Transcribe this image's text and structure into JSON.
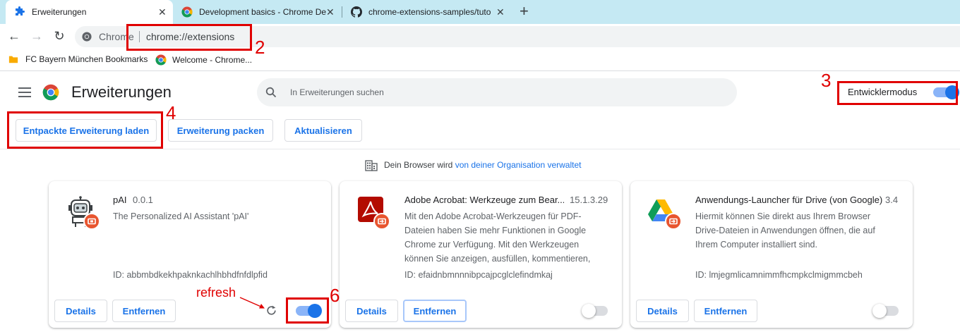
{
  "tabs": [
    {
      "label": "Erweiterungen",
      "icon": "puzzle-icon",
      "active": true
    },
    {
      "label": "Development basics - Chrome De",
      "icon": "chrome-logo-icon",
      "active": false
    },
    {
      "label": "chrome-extensions-samples/tuto",
      "icon": "github-icon",
      "active": false
    }
  ],
  "toolbar": {
    "omnibox_chip": "Chrome",
    "url": "chrome://extensions"
  },
  "bookmarks": [
    {
      "label": "FC Bayern München Bookmarks",
      "icon": "folder-icon"
    },
    {
      "label": "Welcome - Chrome...",
      "icon": "chrome-logo-icon"
    }
  ],
  "header": {
    "title": "Erweiterungen",
    "search_placeholder": "In Erweiterungen suchen",
    "devmode_label": "Entwicklermodus",
    "devmode_on": true
  },
  "actions": {
    "load_unpacked": "Entpackte Erweiterung laden",
    "pack": "Erweiterung packen",
    "update": "Aktualisieren"
  },
  "managed_notice": {
    "text": "Dein Browser wird ",
    "link": "von deiner Organisation verwaltet"
  },
  "extensions": [
    {
      "name": "pAI",
      "version": "0.0.1",
      "description": "The Personalized AI Assistant 'pAI'",
      "id": "ID: abbmbdkekhpaknkachlhbhdfnfdlpfid",
      "details": "Details",
      "remove": "Entfernen",
      "enabled": true
    },
    {
      "name": "Adobe Acrobat: Werkzeuge zum Bear...",
      "version": "15.1.3.29",
      "description": "Mit den Adobe Acrobat-Werkzeugen für PDF-Dateien haben Sie mehr Funktionen in Google Chrome zur Verfügung. Mit den Werkzeugen können Sie anzeigen, ausfüllen, kommentieren,",
      "id": "ID: efaidnbmnnnibpcajpcglclefindmkaj",
      "details": "Details",
      "remove": "Entfernen",
      "enabled": false
    },
    {
      "name": "Anwendungs-Launcher für Drive (von Google)",
      "version": "3.4",
      "description": "Hiermit können Sie direkt aus Ihrem Browser Drive-Dateien in Anwendungen öffnen, die auf Ihrem Computer installiert sind.",
      "id": "ID: lmjegmlicamnimmfhcmpkclmigmmcbeh",
      "details": "Details",
      "remove": "Entfernen",
      "enabled": false
    }
  ],
  "annotations": {
    "n2": "2",
    "n3": "3",
    "n4": "4",
    "n6": "6",
    "refresh": "refresh"
  },
  "colors": {
    "accent": "#1a73e8",
    "annotation_red": "#e00000",
    "tabstrip": "#c5e9f3"
  }
}
